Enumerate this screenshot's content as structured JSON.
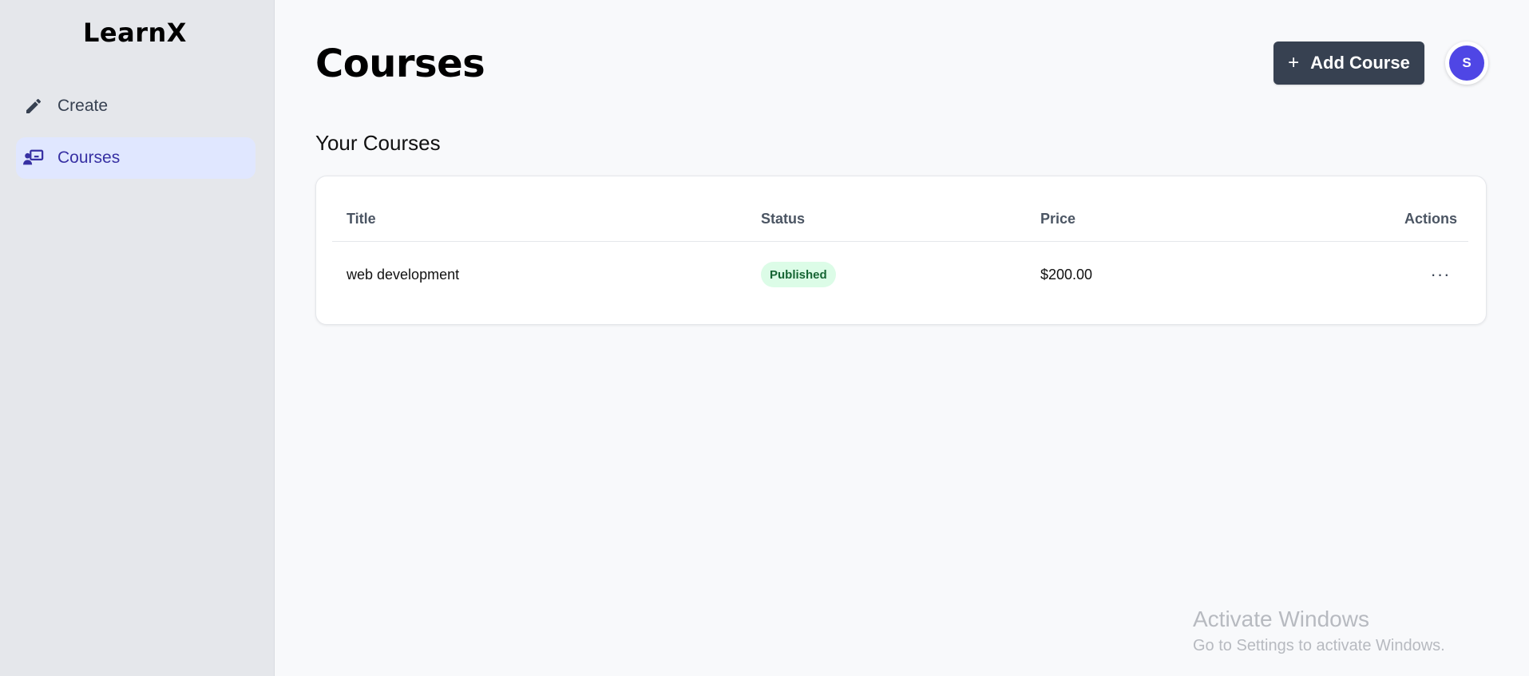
{
  "sidebar": {
    "logo": "LearnX",
    "items": [
      {
        "label": "Create",
        "icon": "pencil-icon",
        "active": false
      },
      {
        "label": "Courses",
        "icon": "teacher-board-icon",
        "active": true
      }
    ]
  },
  "header": {
    "title": "Courses",
    "add_button_label": "Add Course",
    "avatar_initial": "S"
  },
  "section": {
    "title": "Your Courses"
  },
  "table": {
    "columns": [
      "Title",
      "Status",
      "Price",
      "Actions"
    ],
    "rows": [
      {
        "title": "web development",
        "status": "Published",
        "price": "$200.00",
        "actions": "···"
      }
    ]
  },
  "watermark": {
    "line1": "Activate Windows",
    "line2": "Go to Settings to activate Windows."
  },
  "colors": {
    "accent": "#4f46e5",
    "active_nav_bg": "#e0e7ff",
    "button_bg": "#374151",
    "badge_bg": "#dcfce7",
    "badge_text": "#166534"
  }
}
